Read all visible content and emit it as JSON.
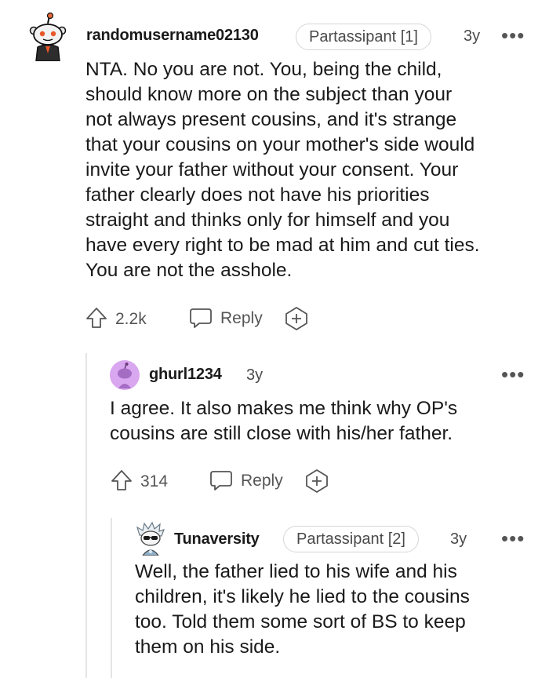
{
  "comments": [
    {
      "username": "randomusername02130",
      "flair": "Partassipant [1]",
      "age": "3y",
      "body": "NTA. No you are not. You, being the child,\nshould know more on the subject than your\nnot always present cousins, and it's strange\nthat your cousins on your mother's side would\ninvite your father without your consent. Your\nfather clearly does not have his priorities\nstraight and thinks only for himself and you\nhave every right to be mad at him and cut ties.\nYou are not the asshole.",
      "upvotes": "2.2k",
      "reply_label": "Reply",
      "more_label": "•••"
    },
    {
      "username": "ghurl1234",
      "age": "3y",
      "body": "I agree. It also makes me think why OP's\ncousins are still close with his/her father.",
      "upvotes": "314",
      "reply_label": "Reply",
      "more_label": "•••"
    },
    {
      "username": "Tunaversity",
      "flair": "Partassipant [2]",
      "age": "3y",
      "body": "Well, the father lied to his wife and his\nchildren, it's likely he lied to the cousins\ntoo. Told them some sort of BS to keep\nthem on his side.",
      "more_label": "•••"
    }
  ],
  "colors": {
    "text": "#1a1a1b",
    "muted": "#555555",
    "thread_line": "#e5e5e5",
    "avatar2_bg": "#d9a6f0"
  },
  "icons": [
    "snoo-avatar-icon",
    "upvote-icon",
    "comment-bubble-icon",
    "award-plus-icon",
    "more-options-icon"
  ]
}
